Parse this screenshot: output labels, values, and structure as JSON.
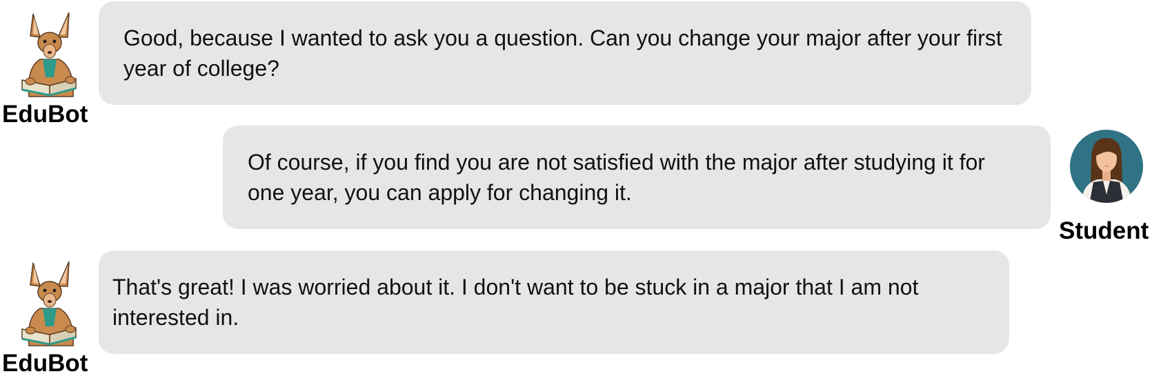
{
  "conversation": {
    "messages": [
      {
        "speaker": "EduBot",
        "side": "left",
        "avatar_icon": "kangaroo-reading-book-icon",
        "text": "Good, because I wanted to ask you a question. Can you change your major after your first year of college?"
      },
      {
        "speaker": "Student",
        "side": "right",
        "avatar_icon": "female-student-icon",
        "text": "Of course, if you find you are not satisfied with the major after studying it for one year, you can apply for changing it."
      },
      {
        "speaker": "EduBot",
        "side": "left",
        "avatar_icon": "kangaroo-reading-book-icon",
        "text": "That's great! I was worried about it. I don't want to be stuck in a major that I am not interested in."
      }
    ]
  },
  "colors": {
    "bubble_background": "#e6e6e8",
    "student_avatar_background": "#2f7384",
    "kangaroo_fur": "#c98a4e",
    "kangaroo_shirt": "#2e9b8a"
  }
}
